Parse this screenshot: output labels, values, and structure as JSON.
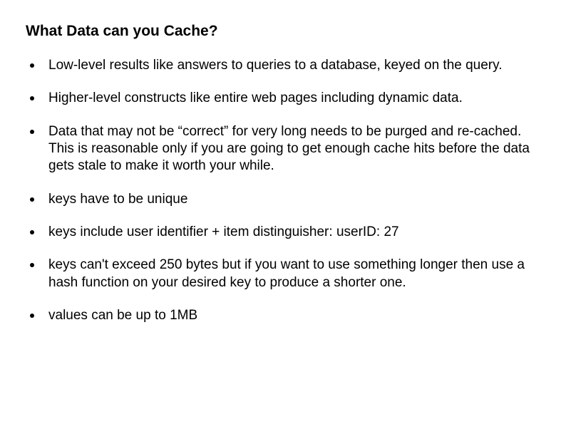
{
  "title": "What Data can you Cache?",
  "bullets": [
    "Low-level results like answers to queries to a database, keyed on the query.",
    "Higher-level constructs like entire web pages including dynamic data.",
    "Data that may not be “correct” for very long needs to be purged and re-cached. This is reasonable only if you are going to get enough cache hits before the data gets stale to make it worth your while.",
    "keys have to be unique",
    "keys include user identifier + item distinguisher: userID: 27",
    "keys can't exceed 250 bytes but if you want to use something longer then use a hash function on your desired key to produce a shorter one.",
    "values can be up to 1MB"
  ]
}
